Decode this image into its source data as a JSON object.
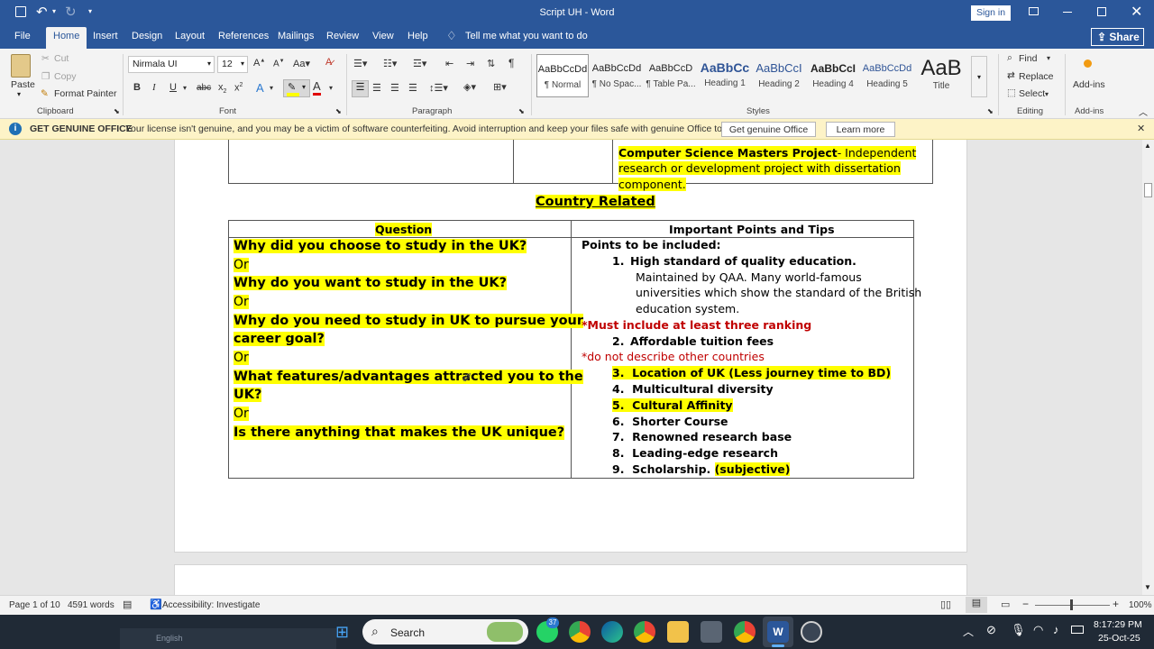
{
  "window": {
    "title": "Script UH  -  Word",
    "sign_in": "Sign in"
  },
  "tabs": [
    "File",
    "Home",
    "Insert",
    "Design",
    "Layout",
    "References",
    "Mailings",
    "Review",
    "View",
    "Help"
  ],
  "tell_me": "Tell me what you want to do",
  "share": "Share",
  "clipboard": {
    "paste": "Paste",
    "cut": "Cut",
    "copy": "Copy",
    "format_painter": "Format Painter",
    "label": "Clipboard"
  },
  "font": {
    "name": "Nirmala UI",
    "size": "12",
    "label": "Font"
  },
  "paragraph": {
    "label": "Paragraph"
  },
  "styles": {
    "label": "Styles",
    "items": [
      {
        "sample": "AaBbCcDd",
        "name": "¶ Normal"
      },
      {
        "sample": "AaBbCcDd",
        "name": "¶ No Spac..."
      },
      {
        "sample": "AaBbCcD",
        "name": "¶ Table Pa..."
      },
      {
        "sample": "AaBbCc",
        "name": "Heading 1"
      },
      {
        "sample": "AaBbCcI",
        "name": "Heading 2"
      },
      {
        "sample": "AaBbCcI",
        "name": "Heading 4"
      },
      {
        "sample": "AaBbCcDd",
        "name": "Heading 5"
      },
      {
        "sample": "AaB",
        "name": "Title"
      }
    ]
  },
  "editing": {
    "find": "Find",
    "replace": "Replace",
    "select": "Select",
    "label": "Editing"
  },
  "addins": {
    "button": "Add-ins",
    "label": "Add-ins"
  },
  "infobar": {
    "title": "GET GENUINE OFFICE",
    "message": "Your license isn't genuine, and you may be a victim of software counterfeiting. Avoid interruption and keep your files safe with genuine Office today.",
    "btn_get": "Get genuine Office",
    "btn_learn": "Learn more"
  },
  "doc": {
    "prev_table": {
      "line1": "Computer Science Masters Project",
      "line1_rest": "- Independent",
      "line2": "research or development project with dissertation",
      "line3": "component."
    },
    "heading": "Country Related",
    "table": {
      "col1": "Question",
      "col2": "Important Points and Tips",
      "questions": [
        "Why did you choose to study in the UK?",
        "Or",
        "Why do you want to study in the UK?",
        "Or",
        "Why do you need to study in UK to pursue your",
        "career goal?",
        "Or",
        "What features/advantages attracted you to the",
        "UK?",
        "Or",
        "Is there anything that makes the UK unique?"
      ],
      "points_intro": "Points to be included:",
      "p1": "High standard of quality education.",
      "p1_detail": [
        "Maintained by QAA. Many world-famous",
        "universities which show the standard of the British",
        "education system."
      ],
      "must": "*Must include at least three ranking",
      "p2": "Affordable tuition fees",
      "donot": "*do not describe other countries",
      "list": [
        {
          "n": "3.",
          "t": "Location of UK (Less journey time to BD)"
        },
        {
          "n": "4.",
          "t": "Multicultural diversity"
        },
        {
          "n": "5.",
          "t": "Cultural Affinity"
        },
        {
          "n": "6.",
          "t": "Shorter Course"
        },
        {
          "n": "7.",
          "t": "Renowned research base"
        },
        {
          "n": "8.",
          "t": "Leading-edge research"
        },
        {
          "n": "9.",
          "t": "Scholarship."
        }
      ],
      "n1": "1.",
      "n2": "2.",
      "subjective": "(subjective)"
    }
  },
  "status": {
    "page": "Page 1 of 10",
    "words": "4591 words",
    "accessibility": "Accessibility: Investigate",
    "zoom": "100%"
  },
  "taskbar": {
    "search": "Search",
    "badge": "37",
    "language": "English",
    "time": "8:17:29 PM",
    "date": "25-Oct-25"
  }
}
